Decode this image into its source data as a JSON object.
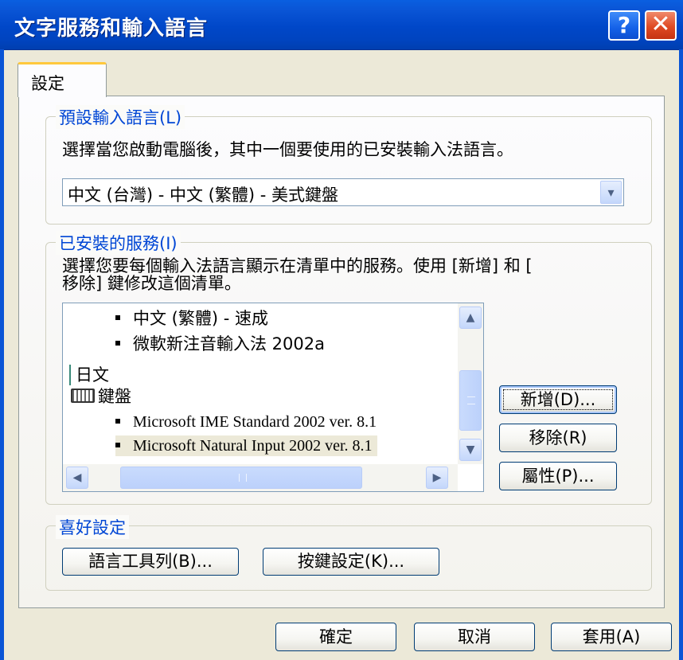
{
  "window": {
    "title": "文字服務和輸入語言",
    "help_glyph": "?",
    "close_glyph": "✕"
  },
  "tabs": [
    {
      "label": "設定"
    }
  ],
  "default_language": {
    "group_label": "預設輸入語言(L)",
    "description": "選擇當您啟動電腦後，其中一個要使用的已安裝輸入法語言。",
    "selected": "中文 (台灣) - 中文 (繁體) - 美式鍵盤",
    "dropdown_glyph": "▾"
  },
  "installed_services": {
    "group_label": "已安裝的服務(I)",
    "description_line1": "選擇您要每個輸入法語言顯示在清單中的服務。使用 [新增] 和 [",
    "description_line2": "移除] 鍵修改這個清單。",
    "items": [
      {
        "label": "中文 (繁體) - 速成"
      },
      {
        "label": "微軟新注音輸入法 2002a"
      },
      {
        "label": "日文"
      },
      {
        "label": "鍵盤"
      },
      {
        "label": "Microsoft IME Standard 2002 ver. 8.1"
      },
      {
        "label": "Microsoft Natural Input 2002 ver. 8.1"
      }
    ],
    "scroll_up_glyph": "▲",
    "scroll_down_glyph": "▼",
    "scroll_left_glyph": "◀",
    "scroll_right_glyph": "▶",
    "add_button": "新增(D)...",
    "remove_button": "移除(R)",
    "properties_button": "屬性(P)..."
  },
  "preferences": {
    "group_label": "喜好設定",
    "language_bar_button": "語言工具列(B)...",
    "key_settings_button": "按鍵設定(K)..."
  },
  "footer": {
    "ok": "確定",
    "cancel": "取消",
    "apply": "套用(A)"
  },
  "colors": {
    "titlebar": "#0a55d6",
    "group_label": "#0046d5",
    "tab_highlight": "#ffc83c",
    "face": "#ece9d8"
  }
}
